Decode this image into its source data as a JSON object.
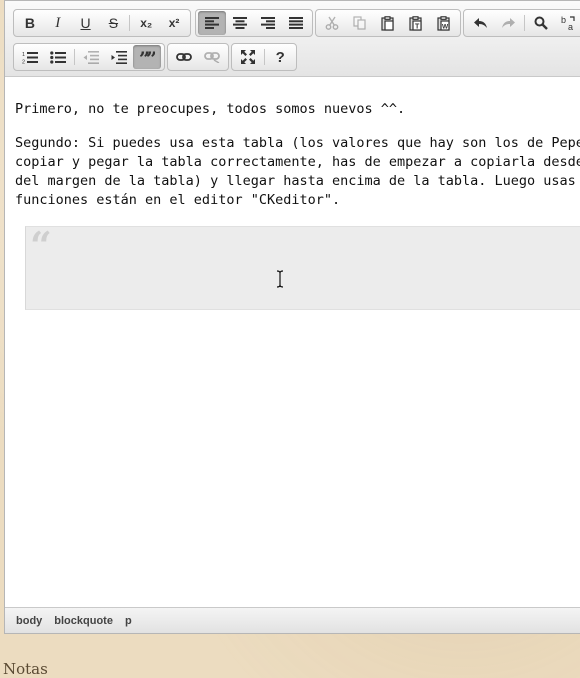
{
  "toolbar": {
    "row1": [
      {
        "group": "basic-styles",
        "buttons": [
          {
            "name": "bold-button",
            "label": "B"
          },
          {
            "name": "italic-button",
            "label": "I"
          },
          {
            "name": "underline-button",
            "label": "U"
          },
          {
            "name": "strike-button",
            "label": "S"
          },
          {
            "sep": true
          },
          {
            "name": "subscript-button",
            "label": "x₂"
          },
          {
            "name": "superscript-button",
            "label": "x²"
          }
        ]
      },
      {
        "group": "align",
        "buttons": [
          {
            "name": "align-left-button",
            "icon": "align-left-icon",
            "state": "on"
          },
          {
            "name": "align-center-button",
            "icon": "align-center-icon"
          },
          {
            "name": "align-right-button",
            "icon": "align-right-icon"
          },
          {
            "name": "justify-button",
            "icon": "justify-icon"
          }
        ]
      },
      {
        "group": "clipboard",
        "buttons": [
          {
            "name": "cut-button",
            "icon": "cut-icon",
            "state": "off"
          },
          {
            "name": "copy-button",
            "icon": "copy-icon",
            "state": "off"
          },
          {
            "name": "paste-button",
            "icon": "paste-icon"
          },
          {
            "name": "paste-text-button",
            "icon": "paste-text-icon"
          },
          {
            "name": "paste-word-button",
            "icon": "paste-word-icon"
          }
        ]
      },
      {
        "group": "history",
        "buttons": [
          {
            "name": "undo-button",
            "icon": "undo-icon"
          },
          {
            "name": "redo-button",
            "icon": "redo-icon",
            "state": "off"
          },
          {
            "sep": true
          },
          {
            "name": "find-button",
            "icon": "find-icon"
          },
          {
            "name": "replace-button",
            "icon": "replace-icon"
          }
        ]
      }
    ],
    "row2": [
      {
        "group": "lists",
        "buttons": [
          {
            "name": "numbered-list-button",
            "icon": "numbered-list-icon"
          },
          {
            "name": "bulleted-list-button",
            "icon": "bulleted-list-icon"
          },
          {
            "sep": true
          },
          {
            "name": "outdent-button",
            "icon": "outdent-icon",
            "state": "off"
          },
          {
            "name": "indent-button",
            "icon": "indent-icon"
          },
          {
            "name": "blockquote-button",
            "icon": "blockquote-icon",
            "state": "on"
          }
        ]
      },
      {
        "group": "links",
        "buttons": [
          {
            "name": "link-button",
            "icon": "link-icon"
          },
          {
            "name": "unlink-button",
            "icon": "unlink-icon",
            "state": "off"
          }
        ]
      },
      {
        "group": "tools",
        "buttons": [
          {
            "name": "maximize-button",
            "icon": "maximize-icon"
          },
          {
            "sep": true
          },
          {
            "name": "about-button",
            "label": "?"
          }
        ]
      }
    ]
  },
  "content": {
    "paragraph1": "Primero, no te preocupes, todos somos nuevos ^^.",
    "paragraph2_lines": [
      "Segundo: Si puedes usa esta tabla (los valores que hay son los de Pepe, un personaje",
      "copiar y pegar la tabla correctamente, has de empezar a copiarla desde debajo de la t",
      "del margen de la tabla) y llegar hasta encima de la tabla. Luego usas las función de \"P",
      "funciones están en el editor \"CKeditor\"."
    ],
    "blockquote_text": ""
  },
  "statusbar": {
    "path": [
      "body",
      "blockquote",
      "p"
    ]
  },
  "below": {
    "notes_label": "Notas"
  }
}
